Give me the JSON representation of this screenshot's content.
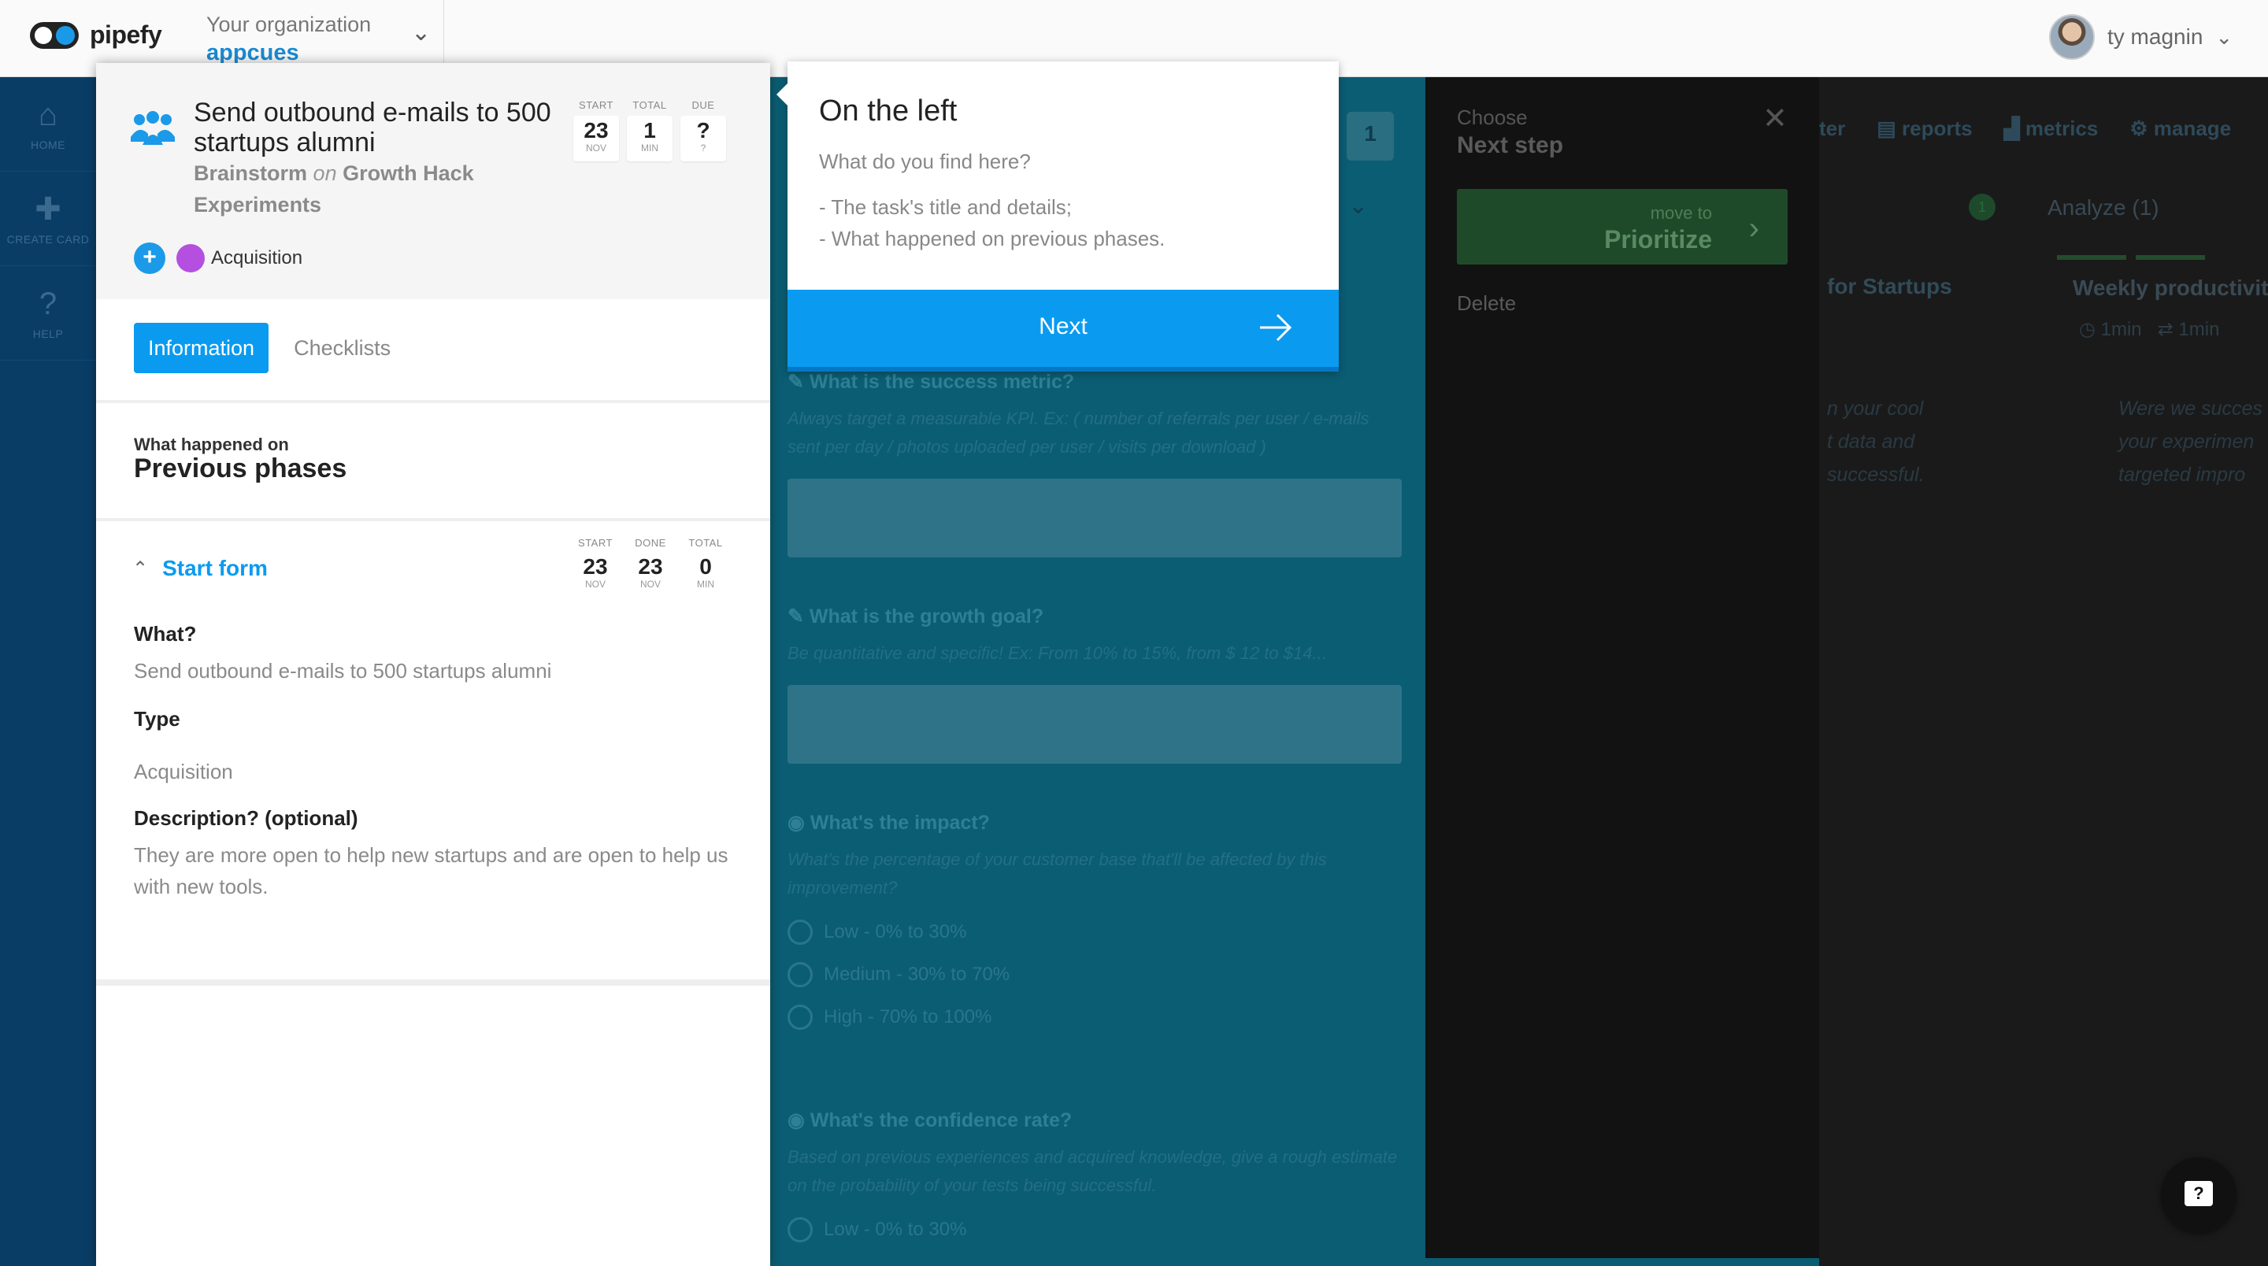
{
  "topbar": {
    "logo_text": "pipefy",
    "org_label": "Your organization",
    "org_name": "appcues",
    "user_name": "ty magnin"
  },
  "leftnav": {
    "items": [
      {
        "label": "HOME",
        "icon": "home-icon"
      },
      {
        "label": "CREATE CARD",
        "icon": "plus-icon"
      },
      {
        "label": "HELP",
        "icon": "question-icon"
      }
    ]
  },
  "card": {
    "title": "Send outbound e-mails to 500 startups alumni",
    "phase": "Brainstorm",
    "on_word": "on",
    "pipe": "Growth Hack Experiments",
    "dates": [
      {
        "label": "START",
        "value": "23",
        "unit": "NOV"
      },
      {
        "label": "TOTAL",
        "value": "1",
        "unit": "MIN"
      },
      {
        "label": "DUE",
        "value": "?",
        "unit": "?"
      }
    ],
    "label": {
      "text": "Acquisition",
      "color": "#b44fe0"
    },
    "tabs": [
      "Information",
      "Checklists"
    ],
    "phases_small": "What happened on",
    "phases_big": "Previous phases",
    "start_form": {
      "title": "Start form",
      "dates": [
        {
          "label": "START",
          "value": "23",
          "unit": "NOV"
        },
        {
          "label": "DONE",
          "value": "23",
          "unit": "NOV"
        },
        {
          "label": "TOTAL",
          "value": "0",
          "unit": "MIN"
        }
      ],
      "fields": [
        {
          "label": "What?",
          "value": "Send outbound e-mails to 500 startups alumni"
        },
        {
          "label": "Type",
          "value": "Acquisition"
        },
        {
          "label": "Description? (optional)",
          "value": "They are more open to help new startups and are open to help us with new tools."
        }
      ]
    }
  },
  "tour": {
    "title": "On the left",
    "question": "What do you find here?",
    "line1": "- The task's title and details;",
    "line2": "- What happened on previous phases.",
    "next_label": "Next"
  },
  "background_form": {
    "counter": "1",
    "questions": [
      {
        "q": "What is the success metric?",
        "hint": "Always target a measurable KPI. Ex: ( number of referrals per user / e-mails sent per day / photos uploaded per user / visits per download )"
      },
      {
        "q": "What is the growth goal?",
        "hint": "Be quantitative and specific! Ex: From 10% to 15%, from $ 12 to $14..."
      },
      {
        "q": "What's the impact?",
        "hint": "What's the percentage of your customer base that'll be affected by this improvement?"
      },
      {
        "q": "What's the confidence rate?",
        "hint": "Based on previous experiences and acquired knowledge, give a rough estimate on the probability of your tests being successful."
      }
    ],
    "impact_options": [
      "Low - 0% to 30%",
      "Medium - 30% to 70%",
      "High - 70% to 100%"
    ],
    "confidence_first": "Low - 0% to 30%"
  },
  "next_step_panel": {
    "choose": "Choose",
    "next_step": "Next step",
    "move_to": "move to",
    "phase": "Prioritize",
    "delete": "Delete"
  },
  "right_board": {
    "nav": [
      "ter",
      "reports",
      "metrics",
      "manage"
    ],
    "badge": "1",
    "analyze": "Analyze",
    "analyze_count": "(1)",
    "col_title": "for Startups",
    "card_title": "Weekly productivit",
    "meta1": "1min",
    "meta2": "1min",
    "text_left": [
      "n your cool",
      "t data and",
      "successful."
    ],
    "text_right": [
      "Were we succes",
      "your experimen",
      "targeted impro"
    ]
  }
}
